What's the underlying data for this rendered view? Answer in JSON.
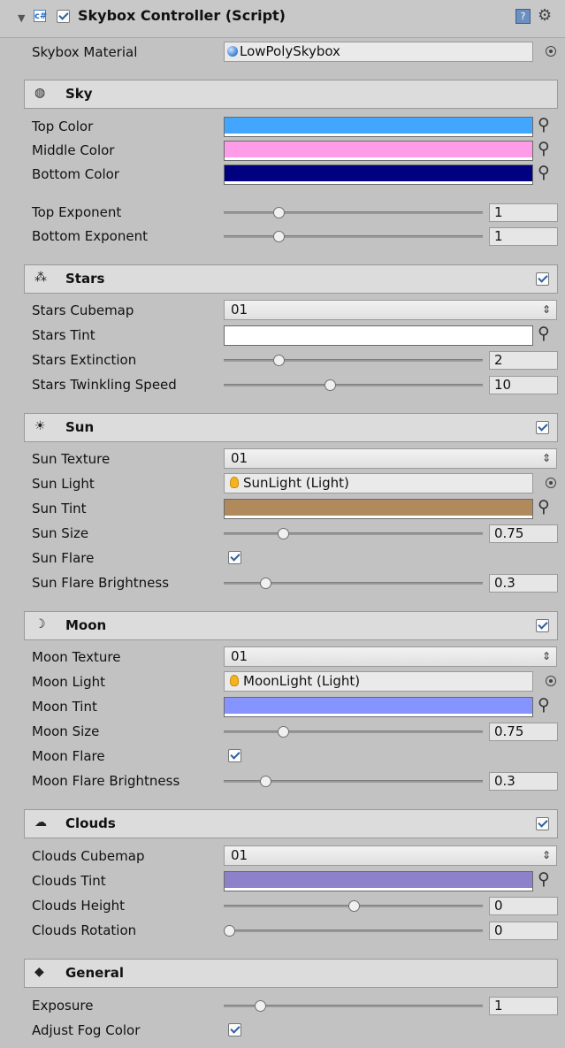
{
  "component": {
    "title": "Skybox Controller (Script)",
    "fold_glyph": "▼",
    "script_glyph": "c#"
  },
  "skybox_material": {
    "label": "Skybox Material",
    "value": "LowPolySkybox"
  },
  "sky": {
    "title": "Sky",
    "icon": "globe-icon",
    "colors": [
      {
        "label": "Top Color",
        "color": "#42a6ff"
      },
      {
        "label": "Middle Color",
        "color": "#ff9ce8"
      },
      {
        "label": "Bottom Color",
        "color": "#000080"
      }
    ],
    "sliders": [
      {
        "label": "Top Exponent",
        "value": "1",
        "fraction": 0.21
      },
      {
        "label": "Bottom Exponent",
        "value": "1",
        "fraction": 0.21
      }
    ]
  },
  "stars": {
    "title": "Stars",
    "icon": "stars-icon",
    "enabled": true,
    "cubemap": {
      "label": "Stars Cubemap",
      "value": "01"
    },
    "tint": {
      "label": "Stars Tint",
      "color": "#ffffff"
    },
    "sliders": [
      {
        "label": "Stars Extinction",
        "value": "2",
        "fraction": 0.21
      },
      {
        "label": "Stars Twinkling Speed",
        "value": "10",
        "fraction": 0.41
      }
    ]
  },
  "sun": {
    "title": "Sun",
    "icon": "sun-icon",
    "enabled": true,
    "texture": {
      "label": "Sun Texture",
      "value": "01"
    },
    "light": {
      "label": "Sun Light",
      "value": "SunLight (Light)"
    },
    "tint": {
      "label": "Sun Tint",
      "color": "#b08a5c"
    },
    "size": {
      "label": "Sun Size",
      "value": "0.75",
      "fraction": 0.23
    },
    "flare": {
      "label": "Sun Flare",
      "checked": true
    },
    "flare_brightness": {
      "label": "Sun Flare Brightness",
      "value": "0.3",
      "fraction": 0.16
    }
  },
  "moon": {
    "title": "Moon",
    "icon": "moon-icon",
    "enabled": true,
    "texture": {
      "label": "Moon Texture",
      "value": "01"
    },
    "light": {
      "label": "Moon Light",
      "value": "MoonLight (Light)"
    },
    "tint": {
      "label": "Moon Tint",
      "color": "#8594ff"
    },
    "size": {
      "label": "Moon Size",
      "value": "0.75",
      "fraction": 0.23
    },
    "flare": {
      "label": "Moon Flare",
      "checked": true
    },
    "flare_brightness": {
      "label": "Moon Flare Brightness",
      "value": "0.3",
      "fraction": 0.16
    }
  },
  "clouds": {
    "title": "Clouds",
    "icon": "cloud-icon",
    "enabled": true,
    "cubemap": {
      "label": "Clouds Cubemap",
      "value": "01"
    },
    "tint": {
      "label": "Clouds Tint",
      "color": "#8d82c9"
    },
    "height": {
      "label": "Clouds Height",
      "value": "0",
      "fraction": 0.5
    },
    "rotation": {
      "label": "Clouds Rotation",
      "value": "0",
      "fraction": 0.02
    }
  },
  "general": {
    "title": "General",
    "icon": "tag-icon",
    "exposure": {
      "label": "Exposure",
      "value": "1",
      "fraction": 0.14
    },
    "adjust_fog": {
      "label": "Adjust Fog Color",
      "checked": true
    }
  },
  "glyphs": {
    "eyedropper": "⚲",
    "dropdown_arrow": "⇕",
    "gear": "⚙",
    "book": "?"
  }
}
